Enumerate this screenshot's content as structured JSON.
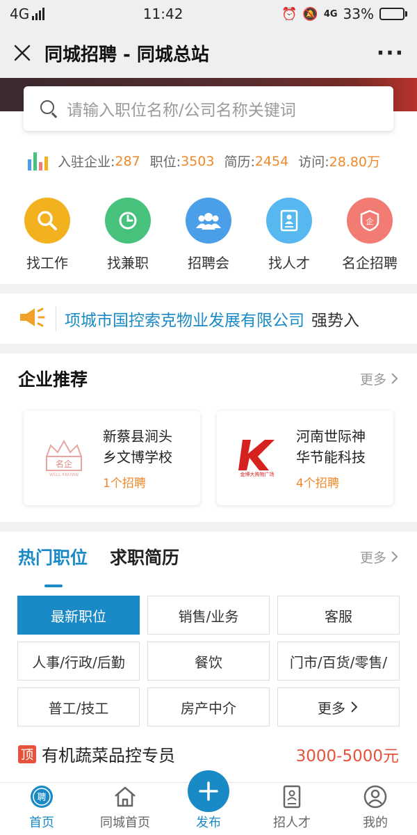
{
  "status_bar": {
    "network": "4G",
    "time": "11:42",
    "battery": "33%",
    "battery_level": 0.33,
    "icons": [
      "alarm-icon",
      "mute-icon",
      "4g-icon",
      "signal-icon",
      "battery-icon"
    ]
  },
  "title_bar": {
    "title": "同城招聘 - 同城总站",
    "more": "···"
  },
  "search": {
    "placeholder": "请输入职位名称/公司名称关键词"
  },
  "stats": {
    "enterprises_label": "入驻企业:",
    "enterprises": "287",
    "jobs_label": "职位:",
    "jobs": "3503",
    "resumes_label": "简历:",
    "resumes": "2454",
    "visits_label": "访问:",
    "visits": "28.80万"
  },
  "quick_links": [
    {
      "label": "找工作",
      "icon": "search-icon",
      "color": "#f2b21f"
    },
    {
      "label": "找兼职",
      "icon": "clock-icon",
      "color": "#47c27c"
    },
    {
      "label": "招聘会",
      "icon": "people-icon",
      "color": "#4a9fe8"
    },
    {
      "label": "找人才",
      "icon": "resume-icon",
      "color": "#57b8f0"
    },
    {
      "label": "名企招聘",
      "icon": "enterprise-icon",
      "color": "#f27b73"
    }
  ],
  "notice": {
    "company": "项城市国控索克物业发展有限公司",
    "suffix": "强势入"
  },
  "enterprise": {
    "title": "企业推荐",
    "more": "更多",
    "cards": [
      {
        "name_line1": "新蔡县涧头",
        "name_line2": "乡文博学校",
        "count": "1个招聘",
        "logo_text": "名企",
        "logo_sub": "WELL KNOWN"
      },
      {
        "name_line1": "河南世际神",
        "name_line2": "华节能科技",
        "count": "4个招聘",
        "logo_text": "K",
        "logo_sub": "金博大购物广场"
      }
    ]
  },
  "jobs": {
    "tab_hot": "热门职位",
    "tab_resume": "求职简历",
    "more": "更多",
    "categories": [
      "最新职位",
      "销售/业务",
      "客服",
      "人事/行政/后勤",
      "餐饮",
      "门市/百货/零售/",
      "普工/技工",
      "房产中介",
      "更多"
    ],
    "listing": {
      "badge": "顶",
      "name": "有机蔬菜品控专员",
      "salary": "3000-5000元"
    }
  },
  "bottom_nav": [
    {
      "label": "首页",
      "icon": "recruit-icon"
    },
    {
      "label": "同城首页",
      "icon": "home-icon"
    },
    {
      "label": "发布",
      "icon": "plus-icon"
    },
    {
      "label": "招人才",
      "icon": "resume-icon"
    },
    {
      "label": "我的",
      "icon": "profile-icon"
    }
  ],
  "colors": {
    "accent": "#1a8ac6",
    "orange": "#f0882a",
    "red": "#e5533d"
  }
}
